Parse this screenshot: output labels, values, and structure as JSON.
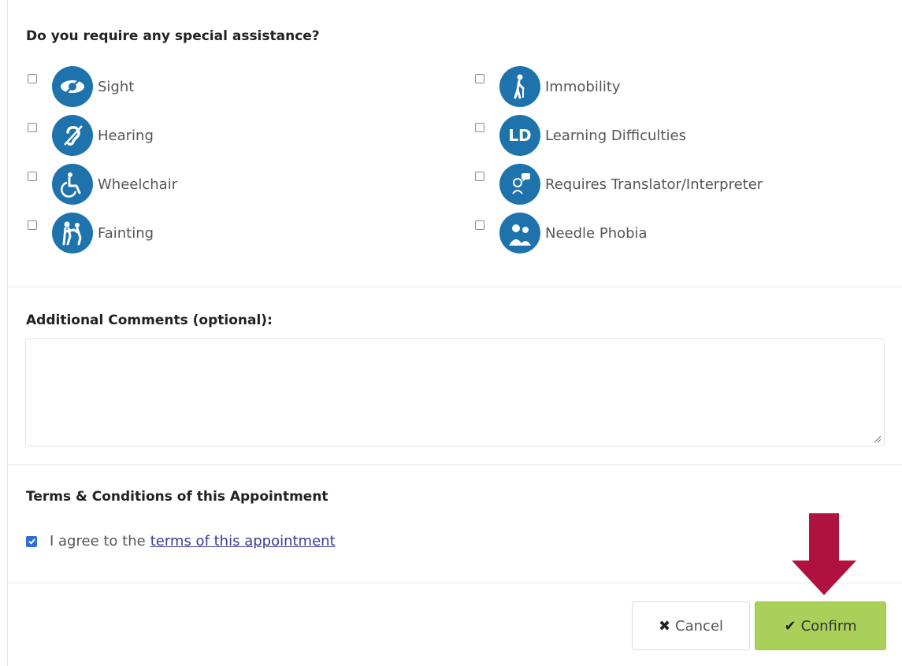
{
  "assistance": {
    "heading": "Do you require any special assistance?",
    "left_options": [
      {
        "label": "Sight",
        "icon": "eye-icon",
        "checked": false
      },
      {
        "label": "Hearing",
        "icon": "ear-icon",
        "checked": false
      },
      {
        "label": "Wheelchair",
        "icon": "wheelchair-icon",
        "checked": false
      },
      {
        "label": "Fainting",
        "icon": "fainting-icon",
        "checked": false
      }
    ],
    "right_options": [
      {
        "label": "Immobility",
        "icon": "walking-cane-icon",
        "checked": false
      },
      {
        "label": "Learning Difficulties",
        "icon": "ld-icon",
        "icon_text": "LD",
        "checked": false
      },
      {
        "label": "Requires Translator/Interpreter",
        "icon": "interpreter-icon",
        "checked": false
      },
      {
        "label": "Needle Phobia",
        "icon": "needle-icon",
        "checked": false
      }
    ],
    "icon_color": "#1e73ad"
  },
  "comments": {
    "heading": "Additional Comments (optional):",
    "value": ""
  },
  "terms": {
    "heading": "Terms & Conditions of this Appointment",
    "agree_prefix": "I agree to the",
    "agree_link": "terms of this appointment",
    "checked": true
  },
  "actions": {
    "cancel_glyph": "✖",
    "cancel_label": "Cancel",
    "confirm_glyph": "✔",
    "confirm_label": "Confirm",
    "confirm_color": "#a9d159",
    "arrow_color": "#b0123f"
  }
}
